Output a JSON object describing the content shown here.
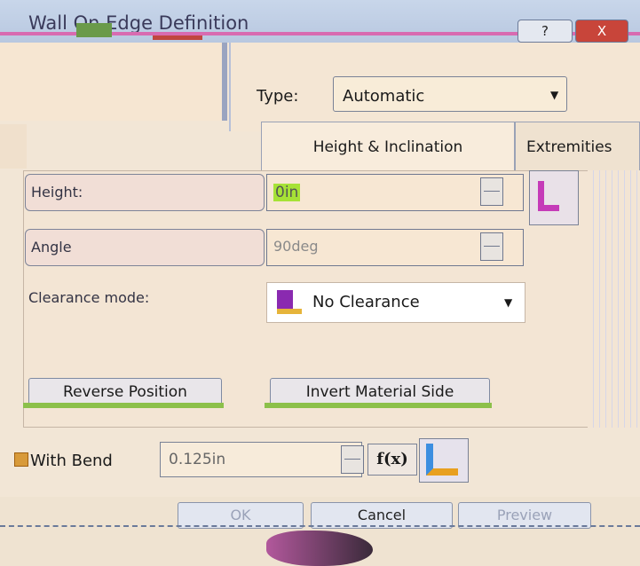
{
  "window": {
    "title": "Wall On Edge Definition",
    "help_label": "?",
    "close_label": "X"
  },
  "type_row": {
    "label": "Type:",
    "value": "Automatic"
  },
  "tabs": [
    {
      "label": "Height & Inclination",
      "selected": true
    },
    {
      "label": "Extremities",
      "selected": false
    }
  ],
  "params": {
    "height": {
      "label": "Height:",
      "value": "0in"
    },
    "angle": {
      "label": "Angle",
      "value": "90deg"
    }
  },
  "clearance": {
    "label": "Clearance mode:",
    "value": "No Clearance"
  },
  "actions": {
    "reverse_label": "Reverse Position",
    "invert_label": "Invert Material Side"
  },
  "bend": {
    "label": "With Bend",
    "checked": true,
    "value": "0.125in",
    "fx_label": "f(x)"
  },
  "footer": {
    "ok_label": "OK",
    "cancel_label": "Cancel",
    "preview_label": "Preview"
  },
  "colors": {
    "background": "#f2e6d6",
    "highlight": "#a6e236",
    "accent_green": "#8cc04a",
    "close_red": "#c8453a"
  }
}
